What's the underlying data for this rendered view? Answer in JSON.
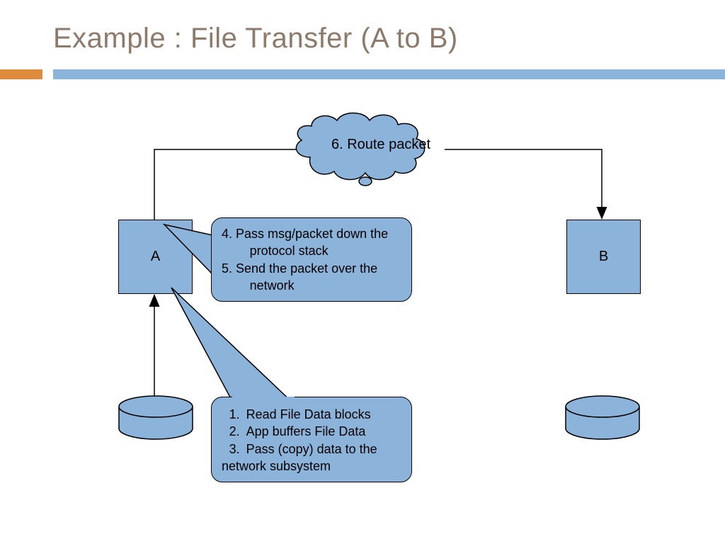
{
  "title": "Example : File Transfer (A to B)",
  "colors": {
    "accent": "#8cb3d9",
    "title": "#8c7a6b",
    "tick": "#dd8b3c"
  },
  "nodes": {
    "a": "A",
    "b": "B"
  },
  "cloud": {
    "label": "6. Route packet"
  },
  "upper_callout": {
    "line1": "4. Pass msg/packet down the",
    "line1b": "protocol stack",
    "line2": "5. Send the packet over the",
    "line2b": "network"
  },
  "lower_callout": {
    "item1": "Read File Data blocks",
    "item2": "App buffers File Data",
    "item3": "Pass (copy) data to the",
    "trail": "network subsystem"
  }
}
